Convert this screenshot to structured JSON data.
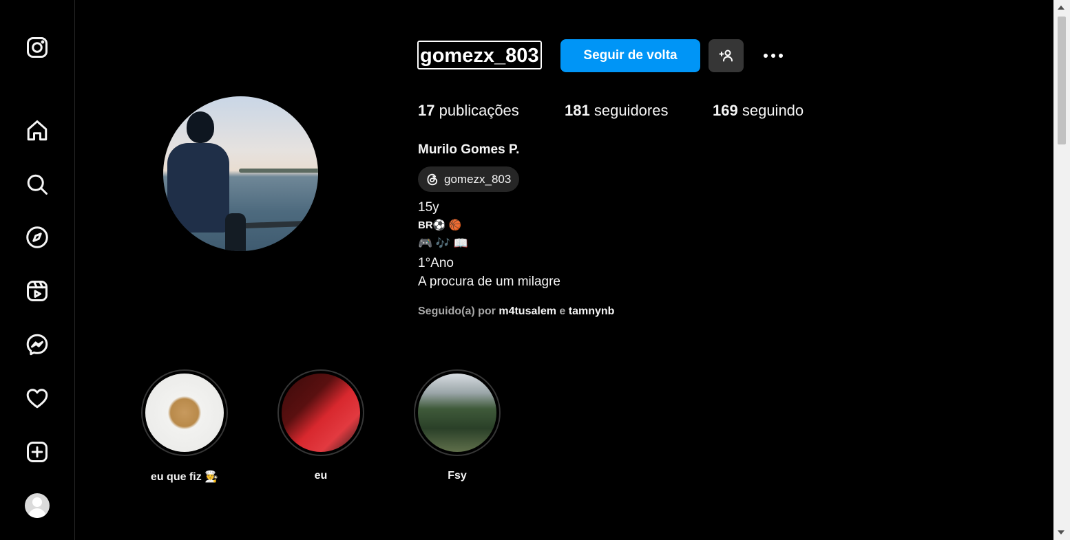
{
  "sidebar": {
    "items": [
      {
        "name": "instagram-logo-icon"
      },
      {
        "name": "home-icon"
      },
      {
        "name": "search-icon"
      },
      {
        "name": "explore-compass-icon"
      },
      {
        "name": "reels-icon"
      },
      {
        "name": "messenger-icon"
      },
      {
        "name": "notifications-heart-icon"
      },
      {
        "name": "create-plus-icon"
      },
      {
        "name": "profile-avatar"
      }
    ]
  },
  "profile": {
    "username": "gomezx_803",
    "follow_button": "Seguir de volta",
    "stats": {
      "posts_count": "17",
      "posts_label": "publicações",
      "followers_count": "181",
      "followers_label": "seguidores",
      "following_count": "169",
      "following_label": "seguindo"
    },
    "full_name": "Murilo Gomes P.",
    "threads_handle": "gomezx_803",
    "bio": {
      "line1": "15y",
      "line2": "BR⚽ 🏀",
      "line3": "🎮 🎶 📖",
      "line4": "1°Ano",
      "line5": "A procura de um milagre"
    },
    "followed_by": {
      "prefix": "Seguido(a) por",
      "user1": "m4tusalem",
      "conj": "e",
      "user2": "tamnynb"
    }
  },
  "highlights": [
    {
      "label": "eu que fiz 🧑‍🍳"
    },
    {
      "label": "eu"
    },
    {
      "label": "Fsy"
    }
  ]
}
